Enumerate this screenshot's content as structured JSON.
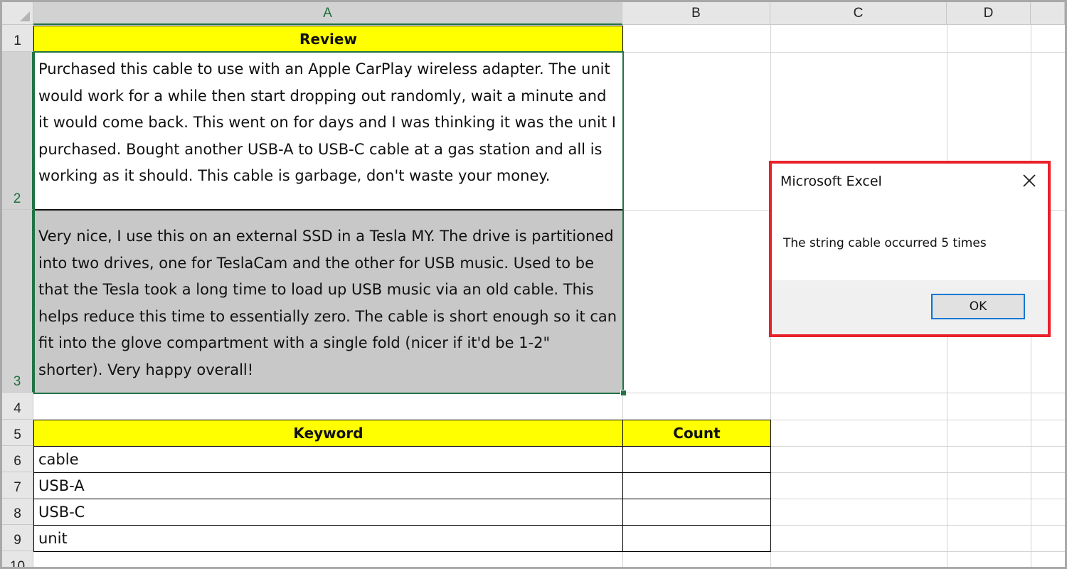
{
  "columns": [
    "A",
    "B",
    "C",
    "D"
  ],
  "rows": [
    "1",
    "2",
    "3",
    "4",
    "5",
    "6",
    "7",
    "8",
    "9",
    "10"
  ],
  "cells": {
    "A1": "Review",
    "A2": "Purchased this cable to use with an Apple CarPlay wireless adapter. The unit would work for a while then start dropping out randomly, wait a minute and it would come back. This went on for days and I was thinking it was the unit I purchased. Bought another USB-A to USB-C cable at a gas station and all is working as it should. This cable is garbage, don't waste your money.",
    "A3": "Very nice, I use this on an external SSD in a Tesla MY. The drive is partitioned into two drives, one for TeslaCam and the other for USB music. Used to be that the Tesla took a long time to load up USB music via an old cable. This helps reduce this time to essentially zero. The cable is short enough so it can fit into the glove compartment with a single fold (nicer if it'd be 1-2\" shorter). Very happy overall!",
    "A5": "Keyword",
    "B5": "Count",
    "A6": "cable",
    "A7": "USB-A",
    "A8": "USB-C",
    "A9": "unit"
  },
  "dialog": {
    "title": "Microsoft Excel",
    "message": "The string cable occurred 5 times",
    "ok_label": "OK"
  },
  "colors": {
    "header_fill": "#ffff00",
    "selected_fill": "#c8c8c8",
    "selection_border": "#217346",
    "dialog_highlight": "#e8212a",
    "button_border": "#0078d7"
  }
}
